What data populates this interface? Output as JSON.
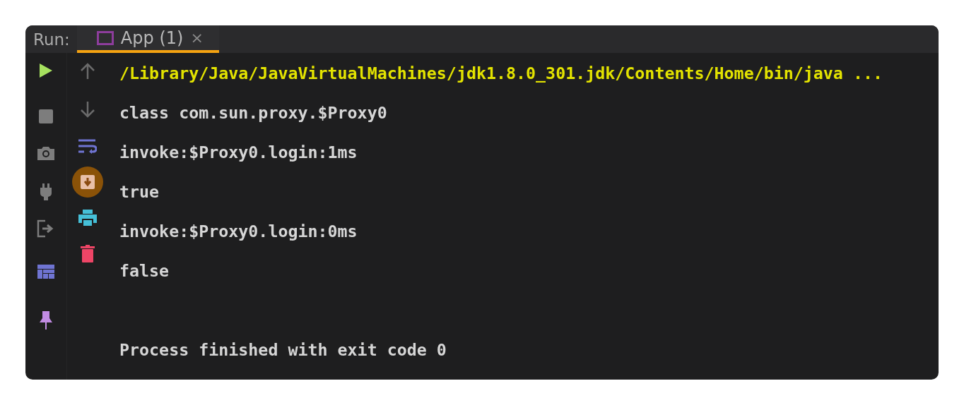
{
  "header": {
    "label": "Run:",
    "tabs": [
      {
        "title": "App (1)",
        "close": "×",
        "selected": true
      }
    ]
  },
  "left_tools": [
    {
      "kind": "play"
    },
    {
      "kind": "stop"
    },
    {
      "kind": "camera"
    },
    {
      "kind": "plug"
    },
    {
      "kind": "exit"
    },
    {
      "kind": "layout"
    },
    {
      "kind": "pin"
    }
  ],
  "right_tools": [
    {
      "kind": "up",
      "on": false
    },
    {
      "kind": "down",
      "on": false
    },
    {
      "kind": "wrap",
      "on": false
    },
    {
      "kind": "scroll",
      "on": true
    },
    {
      "kind": "print",
      "on": false
    },
    {
      "kind": "trash",
      "on": false
    }
  ],
  "console": [
    {
      "kind": "command",
      "text": "/Library/Java/JavaVirtualMachines/jdk1.8.0_301.jdk/Contents/Home/bin/java ..."
    },
    {
      "kind": "output",
      "text": "class com.sun.proxy.$Proxy0"
    },
    {
      "kind": "output",
      "text": "invoke:$Proxy0.login:1ms"
    },
    {
      "kind": "output",
      "text": "true"
    },
    {
      "kind": "output",
      "text": "invoke:$Proxy0.login:0ms"
    },
    {
      "kind": "output",
      "text": "false"
    },
    {
      "kind": "exit",
      "text": "Process finished with exit code 0"
    }
  ]
}
